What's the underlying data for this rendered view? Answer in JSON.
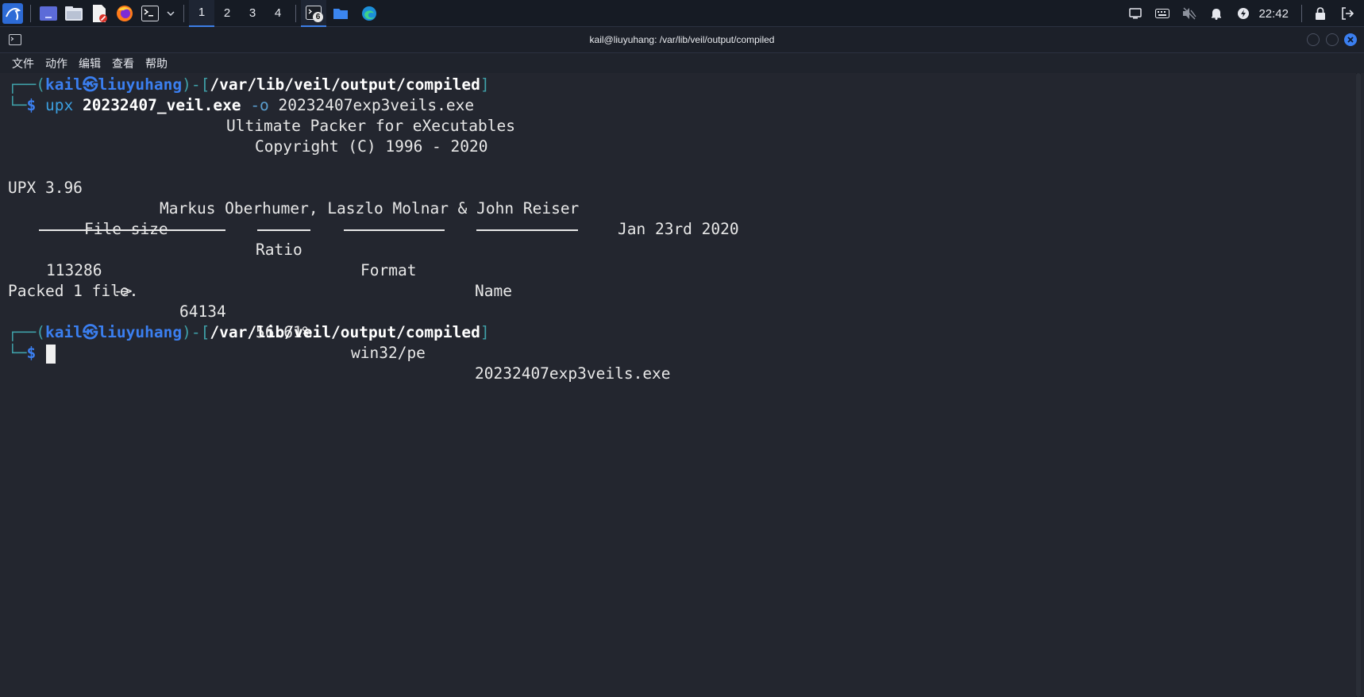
{
  "taskbar": {
    "workspaces": [
      "1",
      "2",
      "3",
      "4"
    ],
    "terminal_badge": "6",
    "clock": "22:42"
  },
  "window": {
    "title": "kail@liuyuhang: /var/lib/veil/output/compiled"
  },
  "menu": {
    "items": [
      "文件",
      "动作",
      "编辑",
      "查看",
      "帮助"
    ]
  },
  "terminal": {
    "prompt1": {
      "open": "┌──(",
      "user": "kail",
      "at": "㉿",
      "host": "liuyuhang",
      "mid": ")-[",
      "path": "/var/lib/veil/output/compiled",
      "close": "]",
      "corner": "└─",
      "dollar": "$"
    },
    "command": {
      "cmd": "upx",
      "arg1": "20232407_veil.exe",
      "opt": "-o",
      "arg2": "20232407exp3veils.exe"
    },
    "banner1": "Ultimate Packer for eXecutables",
    "banner2": "Copyright (C) 1996 - 2020",
    "banner3_version": "UPX 3.96",
    "banner3_authors": "Markus Oberhumer, Laszlo Molnar & John Reiser",
    "banner3_date": "Jan 23rd 2020",
    "table": {
      "headers": [
        "File size",
        "Ratio",
        "Format",
        "Name"
      ],
      "row": {
        "original": "113286",
        "arrow": "->",
        "packed": "64134",
        "ratio": "56.61%",
        "format": "win32/pe",
        "name": "20232407exp3veils.exe"
      }
    },
    "result": "Packed 1 file.",
    "prompt2": {
      "open": "┌──(",
      "user": "kail",
      "at": "㉿",
      "host": "liuyuhang",
      "mid": ")-[",
      "path": "/var/lib/veil/output/compiled",
      "close": "]",
      "corner": "└─",
      "dollar": "$"
    }
  }
}
